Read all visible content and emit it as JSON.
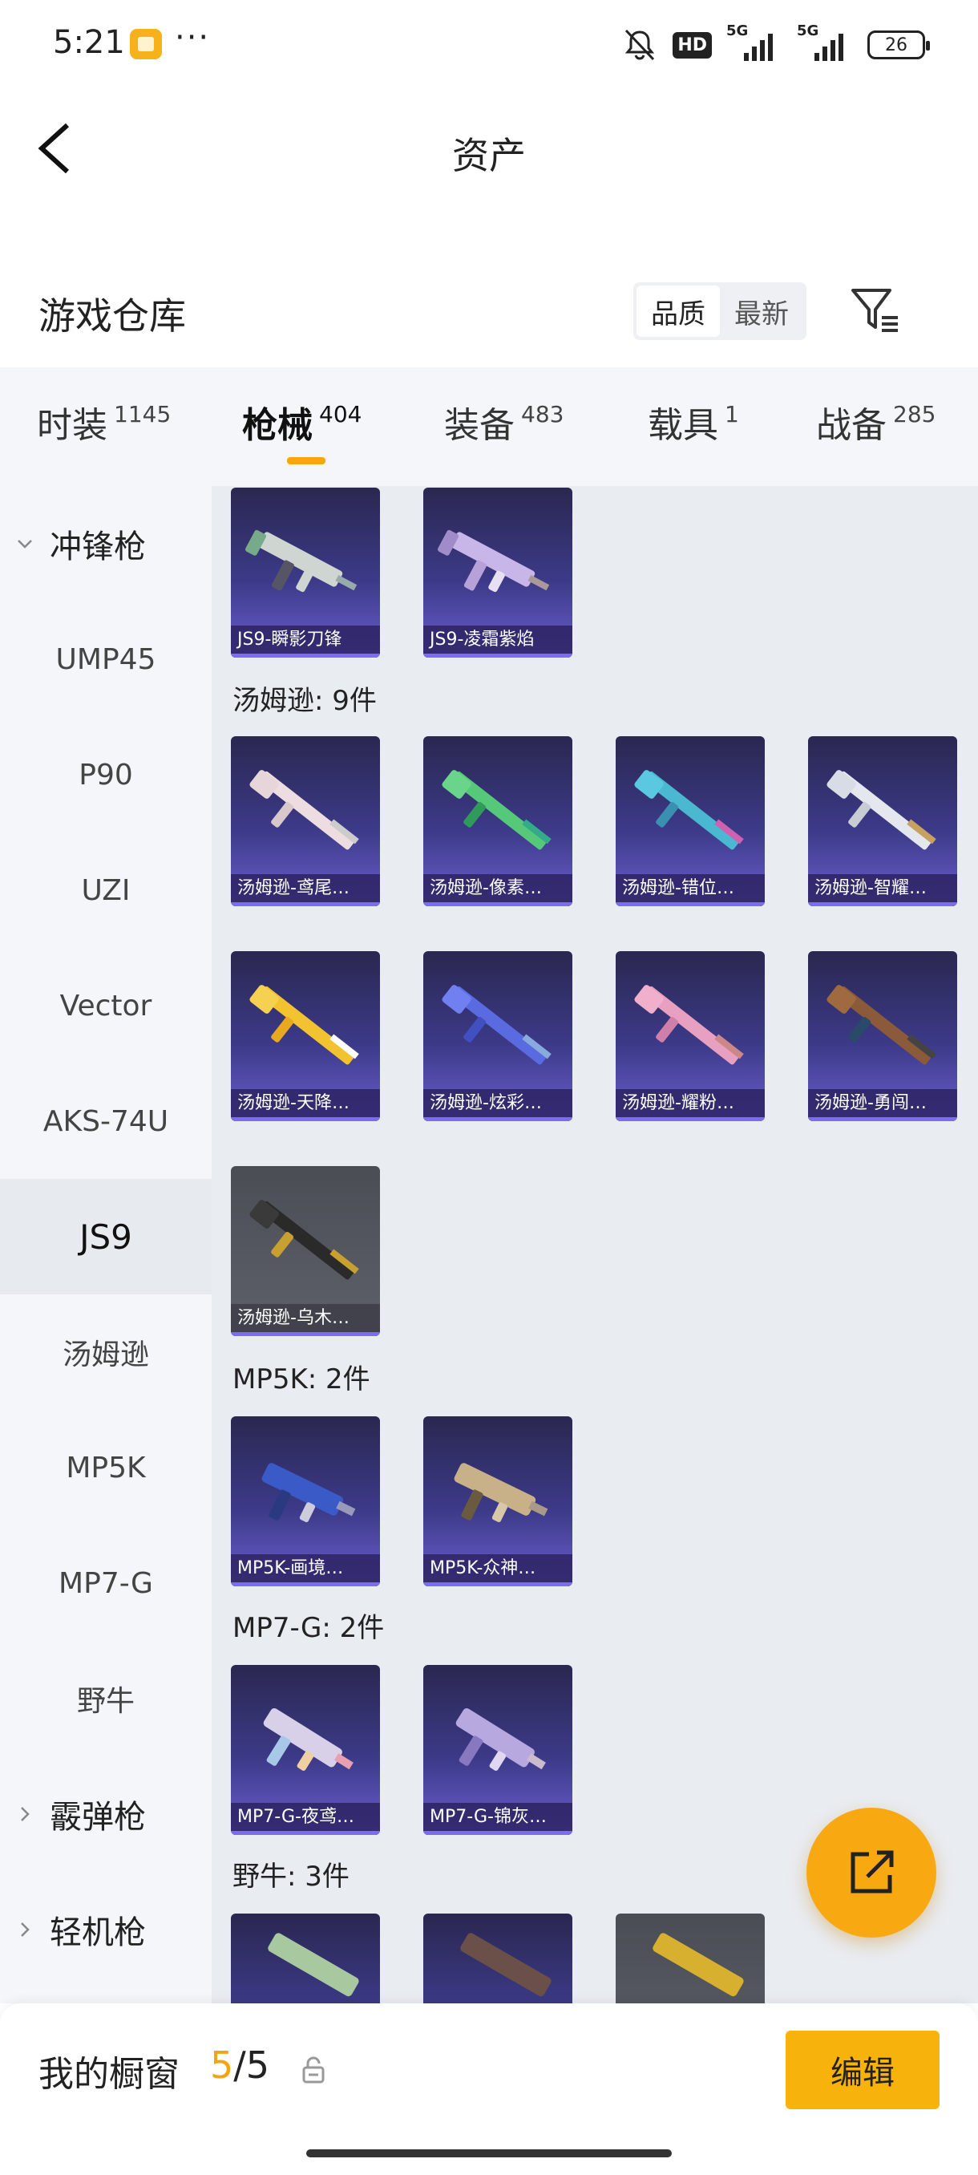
{
  "status_bar": {
    "time": "5:21",
    "dots": "···",
    "hd": "HD",
    "sim1": "5G",
    "sim2": "5G",
    "battery": "26"
  },
  "header": {
    "title": "资产"
  },
  "warehouse": {
    "title": "游戏仓库",
    "sort_options": [
      "品质",
      "最新"
    ],
    "active_sort": "品质"
  },
  "tabs": [
    {
      "label": "时装",
      "count": "1145"
    },
    {
      "label": "枪械",
      "count": "404"
    },
    {
      "label": "装备",
      "count": "483"
    },
    {
      "label": "载具",
      "count": "1"
    },
    {
      "label": "战备",
      "count": "285"
    }
  ],
  "sidebar": [
    {
      "label": "冲锋枪",
      "type": "group"
    },
    {
      "label": "UMP45"
    },
    {
      "label": "P90"
    },
    {
      "label": "UZI"
    },
    {
      "label": "Vector"
    },
    {
      "label": "AKS-74U"
    },
    {
      "label": "JS9",
      "selected": true
    },
    {
      "label": "汤姆逊"
    },
    {
      "label": "MP5K"
    },
    {
      "label": "MP7-G"
    },
    {
      "label": "野牛"
    },
    {
      "label": "霰弹枪",
      "type": "group"
    },
    {
      "label": "轻机枪",
      "type": "group"
    }
  ],
  "sections": {
    "js9": {
      "items": [
        "JS9-瞬影刀锋",
        "JS9-凌霜紫焰"
      ]
    },
    "thompson": {
      "heading": "汤姆逊: 9件",
      "items": [
        "汤姆逊-鸢尾…",
        "汤姆逊-像素…",
        "汤姆逊-错位…",
        "汤姆逊-智耀…",
        "汤姆逊-天降…",
        "汤姆逊-炫彩…",
        "汤姆逊-耀粉…",
        "汤姆逊-勇闯…",
        "汤姆逊-乌木…"
      ]
    },
    "mp5k": {
      "heading": "MP5K: 2件",
      "items": [
        "MP5K-画境…",
        "MP5K-众神…"
      ]
    },
    "mp7g": {
      "heading": "MP7-G: 2件",
      "items": [
        "MP7-G-夜鸢…",
        "MP7-G-锦灰…"
      ]
    },
    "bizon": {
      "heading": "野牛: 3件"
    }
  },
  "showcase": {
    "label": "我的橱窗",
    "current": "5",
    "sep": "/",
    "total": "5",
    "edit_label": "编辑"
  },
  "colors": {
    "accent": "#f8b20c",
    "card_bg": "#3c3a88",
    "card_border": "#7b6cf2"
  }
}
